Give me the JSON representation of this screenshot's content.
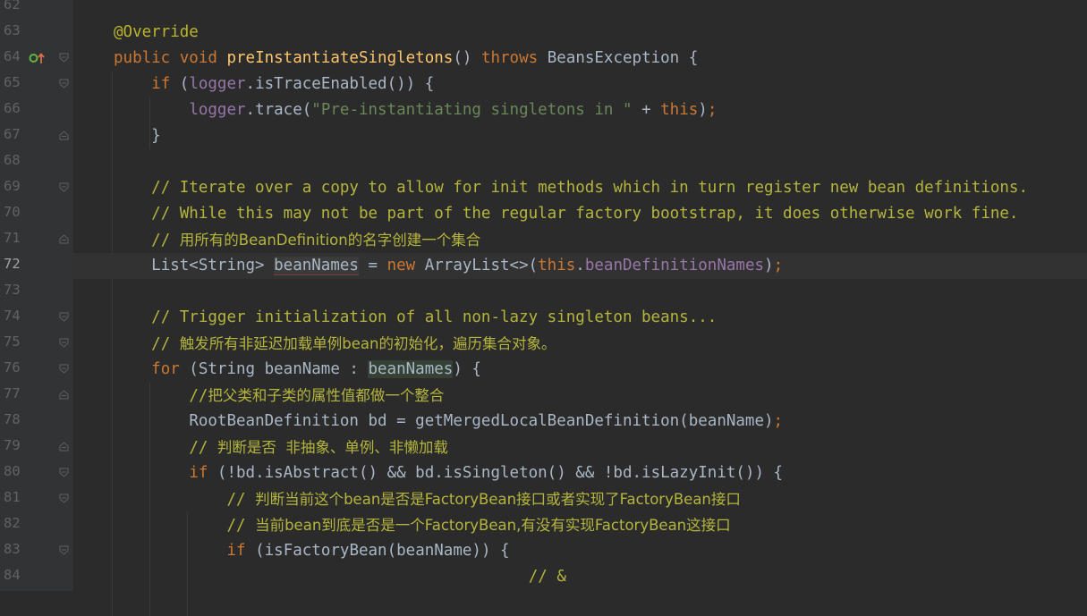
{
  "editor": {
    "current_line": "72",
    "lines": [
      {
        "number": "62",
        "indent": 0,
        "tokens": []
      },
      {
        "number": "63",
        "indent": 1,
        "tokens": [
          {
            "t": "@Override",
            "c": "ann"
          }
        ]
      },
      {
        "number": "64",
        "indent": 1,
        "tokens": [
          {
            "t": "public",
            "c": "kw"
          },
          {
            "t": " "
          },
          {
            "t": "void",
            "c": "kw"
          },
          {
            "t": " "
          },
          {
            "t": "preInstantiateSingletons",
            "c": "fn"
          },
          {
            "t": "() "
          },
          {
            "t": "throws",
            "c": "kw"
          },
          {
            "t": " BeansException {"
          }
        ]
      },
      {
        "number": "65",
        "indent": 2,
        "tokens": [
          {
            "t": "if",
            "c": "kw"
          },
          {
            "t": " ("
          },
          {
            "t": "logger",
            "c": "fld"
          },
          {
            "t": ".isTraceEnabled()) {"
          }
        ]
      },
      {
        "number": "66",
        "indent": 3,
        "tokens": [
          {
            "t": "logger",
            "c": "fld"
          },
          {
            "t": ".trace("
          },
          {
            "t": "\"Pre-instantiating singletons in \"",
            "c": "str"
          },
          {
            "t": " + "
          },
          {
            "t": "this",
            "c": "kw"
          },
          {
            "t": ")"
          },
          {
            "t": ";",
            "c": "kw"
          }
        ]
      },
      {
        "number": "67",
        "indent": 2,
        "tokens": [
          {
            "t": "}"
          }
        ]
      },
      {
        "number": "68",
        "indent": 0,
        "tokens": []
      },
      {
        "number": "69",
        "indent": 2,
        "tokens": [
          {
            "t": "// Iterate over a copy to allow for init methods which in turn register new bean definitions.",
            "c": "cmt"
          }
        ]
      },
      {
        "number": "70",
        "indent": 2,
        "tokens": [
          {
            "t": "// While this may not be part of the regular factory bootstrap, it does otherwise work fine.",
            "c": "cmt"
          }
        ]
      },
      {
        "number": "71",
        "indent": 2,
        "tokens": [
          {
            "t": "// ",
            "c": "cmt"
          },
          {
            "t": "用所有的BeanDefinition的名字创建一个集合",
            "c": "cmt cjk"
          }
        ]
      },
      {
        "number": "72",
        "indent": 2,
        "tokens": [
          {
            "t": "List<String> "
          },
          {
            "t": "beanNames",
            "c": "hl-read"
          },
          {
            "t": " = "
          },
          {
            "t": "new",
            "c": "kw"
          },
          {
            "t": " ArrayList<>("
          },
          {
            "t": "this",
            "c": "kw"
          },
          {
            "t": "."
          },
          {
            "t": "beanDefinitionNames",
            "c": "fld"
          },
          {
            "t": ")"
          },
          {
            "t": ";",
            "c": "kw"
          }
        ]
      },
      {
        "number": "73",
        "indent": 0,
        "tokens": []
      },
      {
        "number": "74",
        "indent": 2,
        "tokens": [
          {
            "t": "// Trigger initialization of all non-lazy singleton beans...",
            "c": "cmt"
          }
        ]
      },
      {
        "number": "75",
        "indent": 2,
        "tokens": [
          {
            "t": "// ",
            "c": "cmt"
          },
          {
            "t": "触发所有非延迟加载单例bean的初始化，遍历集合对象。",
            "c": "cmt cjk"
          }
        ]
      },
      {
        "number": "76",
        "indent": 2,
        "tokens": [
          {
            "t": "for",
            "c": "kw"
          },
          {
            "t": " (String beanName : "
          },
          {
            "t": "beanNames",
            "c": "hl-var"
          },
          {
            "t": ") {"
          }
        ]
      },
      {
        "number": "77",
        "indent": 3,
        "tokens": [
          {
            "t": "//",
            "c": "cmt"
          },
          {
            "t": "把父类和子类的属性值都做一个整合",
            "c": "cmt cjk"
          }
        ]
      },
      {
        "number": "78",
        "indent": 3,
        "tokens": [
          {
            "t": "RootBeanDefinition bd = getMergedLocalBeanDefinition(beanName)"
          },
          {
            "t": ";",
            "c": "kw"
          }
        ]
      },
      {
        "number": "79",
        "indent": 3,
        "tokens": [
          {
            "t": "// ",
            "c": "cmt"
          },
          {
            "t": "判断是否  非抽象、单例、非懒加载",
            "c": "cmt cjk"
          }
        ]
      },
      {
        "number": "80",
        "indent": 3,
        "tokens": [
          {
            "t": "if",
            "c": "kw"
          },
          {
            "t": " (!bd.isAbstract() && bd.isSingleton() && !bd.isLazyInit()) {"
          }
        ]
      },
      {
        "number": "81",
        "indent": 4,
        "tokens": [
          {
            "t": "// ",
            "c": "cmt"
          },
          {
            "t": "判断当前这个bean是否是FactoryBean接口或者实现了FactoryBean接口",
            "c": "cmt cjk"
          }
        ]
      },
      {
        "number": "82",
        "indent": 4,
        "tokens": [
          {
            "t": "// ",
            "c": "cmt"
          },
          {
            "t": "当前bean到底是否是一个FactoryBean,有没有实现FactoryBean这接口",
            "c": "cmt cjk"
          }
        ]
      },
      {
        "number": "83",
        "indent": 4,
        "tokens": [
          {
            "t": "if",
            "c": "kw"
          },
          {
            "t": " (isFactoryBean(beanName)) {"
          }
        ]
      },
      {
        "number": "84",
        "indent": 12,
        "tokens": [
          {
            "t": "// &",
            "c": "cmt"
          }
        ]
      }
    ]
  },
  "gutter": {
    "override_icon": "override-up-arrow-icon",
    "fold_open_lines": [
      "64",
      "65",
      "69",
      "74",
      "75",
      "76",
      "80",
      "81",
      "83"
    ],
    "fold_close_lines": [
      "67",
      "71",
      "77",
      "79"
    ]
  },
  "colors": {
    "background": "#2b2b2b",
    "gutter": "#313335",
    "keyword": "#cc7832",
    "annotation": "#bbb529",
    "method": "#ffc66d",
    "string": "#6a8759",
    "field": "#9876aa",
    "comment": "#b5b53e",
    "text": "#a9b7c6"
  }
}
